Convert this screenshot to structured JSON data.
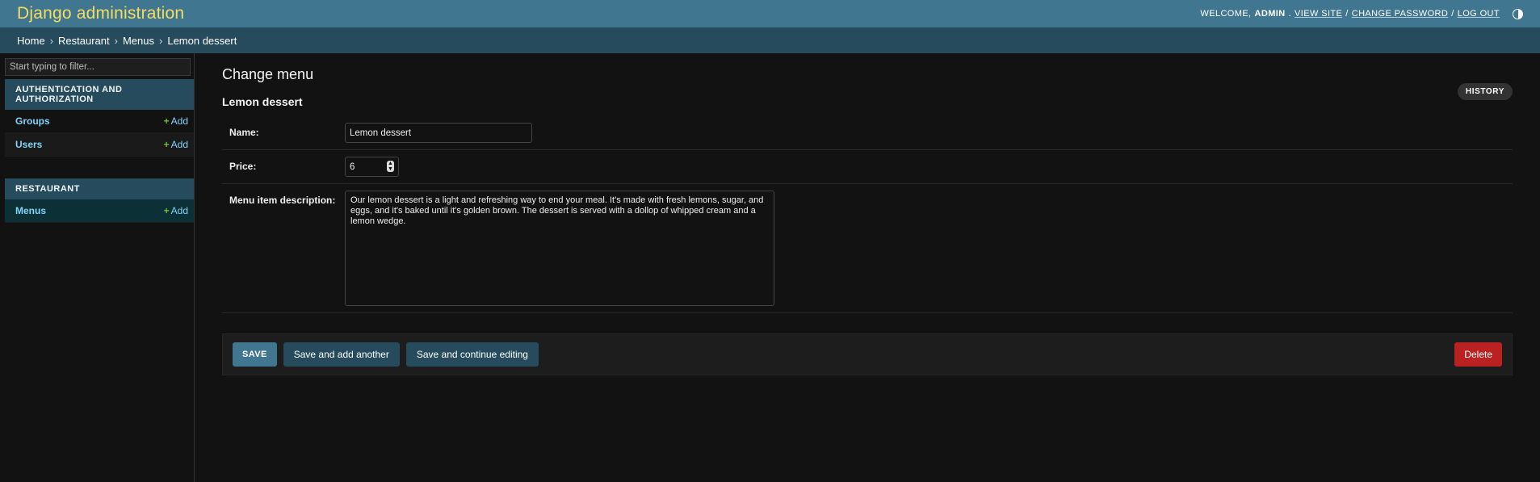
{
  "header": {
    "site_name": "Django administration",
    "welcome": "WELCOME,",
    "username": "ADMIN",
    "links": [
      "VIEW SITE",
      "CHANGE PASSWORD",
      "LOG OUT"
    ]
  },
  "breadcrumbs": [
    "Home",
    "Restaurant",
    "Menus",
    "Lemon dessert"
  ],
  "sidebar": {
    "filter_placeholder": "Start typing to filter...",
    "modules": [
      {
        "caption": "AUTHENTICATION AND AUTHORIZATION",
        "models": [
          {
            "name": "Groups",
            "add": "Add"
          },
          {
            "name": "Users",
            "add": "Add"
          }
        ]
      },
      {
        "caption": "RESTAURANT",
        "models": [
          {
            "name": "Menus",
            "add": "Add"
          }
        ]
      }
    ]
  },
  "content": {
    "heading": "Change menu",
    "object_title": "Lemon dessert",
    "history_label": "HISTORY",
    "fields": {
      "name": {
        "label": "Name:",
        "value": "Lemon dessert"
      },
      "price": {
        "label": "Price:",
        "value": "6"
      },
      "description": {
        "label": "Menu item description:",
        "value": "Our lemon dessert is a light and refreshing way to end your meal. It's made with fresh lemons, sugar, and eggs, and it's baked until it's golden brown. The dessert is served with a dollop of whipped cream and a lemon wedge."
      }
    },
    "buttons": {
      "save": "SAVE",
      "save_add_another": "Save and add another",
      "save_continue": "Save and continue editing",
      "delete": "Delete"
    }
  },
  "colors": {
    "header_bg": "#417690",
    "breadcrumbs_bg": "#264b5d",
    "brand_text": "#f5dd5d",
    "link": "#81d4fa",
    "delete_bg": "#ba2121"
  }
}
